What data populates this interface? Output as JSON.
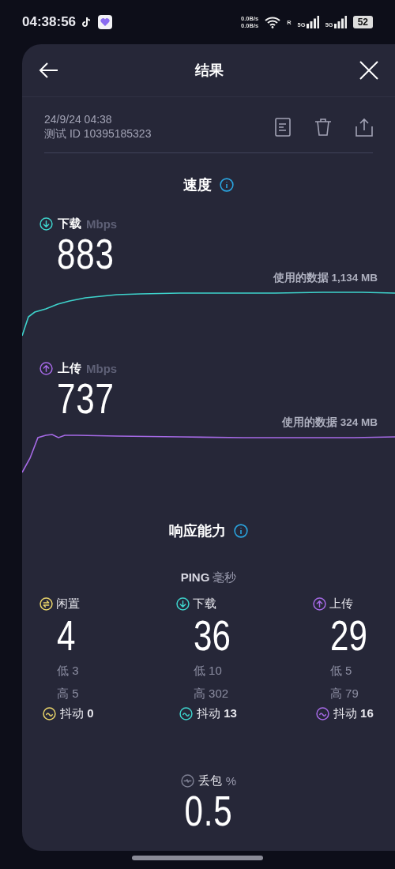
{
  "status_bar": {
    "time": "04:38:56",
    "net_up": "0.0B/s",
    "net_down": "0.0B/s",
    "roaming": "R",
    "sims": [
      "5G",
      "5G"
    ],
    "battery": "52"
  },
  "header": {
    "title": "结果"
  },
  "meta": {
    "datetime": "24/9/24 04:38",
    "test_id": "测试 ID 10395185323"
  },
  "speed": {
    "title": "速度",
    "metrics": [
      {
        "kind": "download",
        "label": "下载",
        "unit": "Mbps",
        "value": "883",
        "data_used": "使用的数据 1,134 MB",
        "color": "#3ed3cc"
      },
      {
        "kind": "upload",
        "label": "上传",
        "unit": "Mbps",
        "value": "737",
        "data_used": "使用的数据 324 MB",
        "color": "#a66ae6"
      }
    ]
  },
  "responsiveness": {
    "title": "响应能力",
    "ping": {
      "label": "PING",
      "unit": "毫秒"
    },
    "columns": [
      {
        "kind": "idle",
        "label": "闲置",
        "value": "4",
        "low": "低 3",
        "high": "高 5",
        "jitter": "抖动 **0**",
        "color": "#e9d46a"
      },
      {
        "kind": "download",
        "label": "下载",
        "value": "36",
        "low": "低 10",
        "high": "高 302",
        "jitter": "抖动 **13**",
        "color": "#3ed3cc"
      },
      {
        "kind": "upload",
        "label": "上传",
        "value": "29",
        "low": "低 5",
        "high": "高 79",
        "jitter": "抖动 **16**",
        "color": "#a66ae6"
      }
    ],
    "packet_loss": {
      "label": "丢包",
      "unit": "%",
      "value": "0.5"
    }
  }
}
